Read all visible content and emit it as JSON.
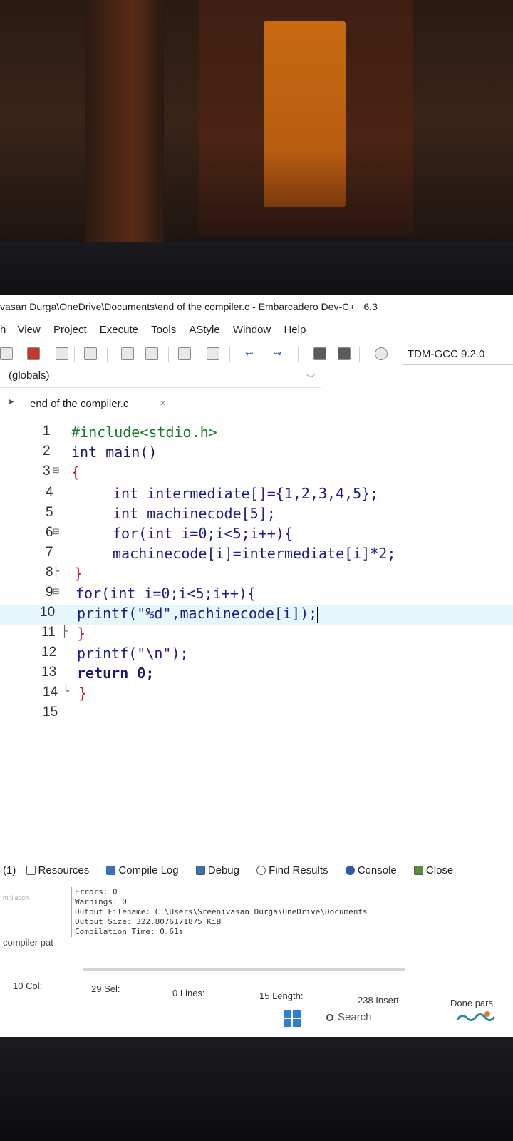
{
  "window": {
    "title": "vasan Durga\\OneDrive\\Documents\\end of the compiler.c - Embarcadero Dev-C++ 6.3"
  },
  "menu": [
    "h",
    "View",
    "Project",
    "Execute",
    "Tools",
    "AStyle",
    "Window",
    "Help"
  ],
  "toolbar": {
    "compiler": "TDM-GCC 9.2.0"
  },
  "scope": {
    "value": "(globals)"
  },
  "tab": {
    "filename": "end of the compiler.c",
    "close": "×"
  },
  "editor": {
    "lines": [
      {
        "num": "1",
        "fold": "",
        "code": "#include<stdio.h>"
      },
      {
        "num": "2",
        "fold": "",
        "code": "int main()"
      },
      {
        "num": "3",
        "fold": "⊟",
        "code": "{"
      },
      {
        "num": "4",
        "fold": "",
        "code": "int intermediate[]={1,2,3,4,5};"
      },
      {
        "num": "5",
        "fold": "",
        "code": "int machinecode[5];"
      },
      {
        "num": "6",
        "fold": "⊟",
        "code": "for(int i=0;i<5;i++){"
      },
      {
        "num": "7",
        "fold": "",
        "code": "machinecode[i]=intermediate[i]*2;"
      },
      {
        "num": "8",
        "fold": "├",
        "code": "}"
      },
      {
        "num": "9",
        "fold": "⊟",
        "code": "for(int i=0;i<5;i++){"
      },
      {
        "num": "10",
        "fold": "",
        "code": "printf(\"%d\",machinecode[i]);"
      },
      {
        "num": "11",
        "fold": "├",
        "code": "}"
      },
      {
        "num": "12",
        "fold": "",
        "code": "printf(\"\\n\");"
      },
      {
        "num": "13",
        "fold": "",
        "code": "return 0;"
      },
      {
        "num": "14",
        "fold": "└",
        "code": "}"
      },
      {
        "num": "15",
        "fold": "",
        "code": ""
      }
    ]
  },
  "bottom_panel": {
    "tabs": [
      "(1)",
      "Resources",
      "Compile Log",
      "Debug",
      "Find Results",
      "Console",
      "Close"
    ],
    "left_label_faded": "mpilation",
    "left_label": "compiler pat",
    "log": [
      "Errors: 0",
      "Warnings: 0",
      "Output Filename: C:\\Users\\Sreenivasan Durga\\OneDrive\\Documents",
      "Output Size: 322.8076171875 KiB",
      "Compilation Time: 0.61s"
    ]
  },
  "status": {
    "col": "10 Col:",
    "sel": "29 Sel:",
    "lines": "0 Lines:",
    "length": "15 Length:",
    "insert": "238 Insert",
    "parsing": "Done pars"
  },
  "taskbar": {
    "search": "Search"
  }
}
